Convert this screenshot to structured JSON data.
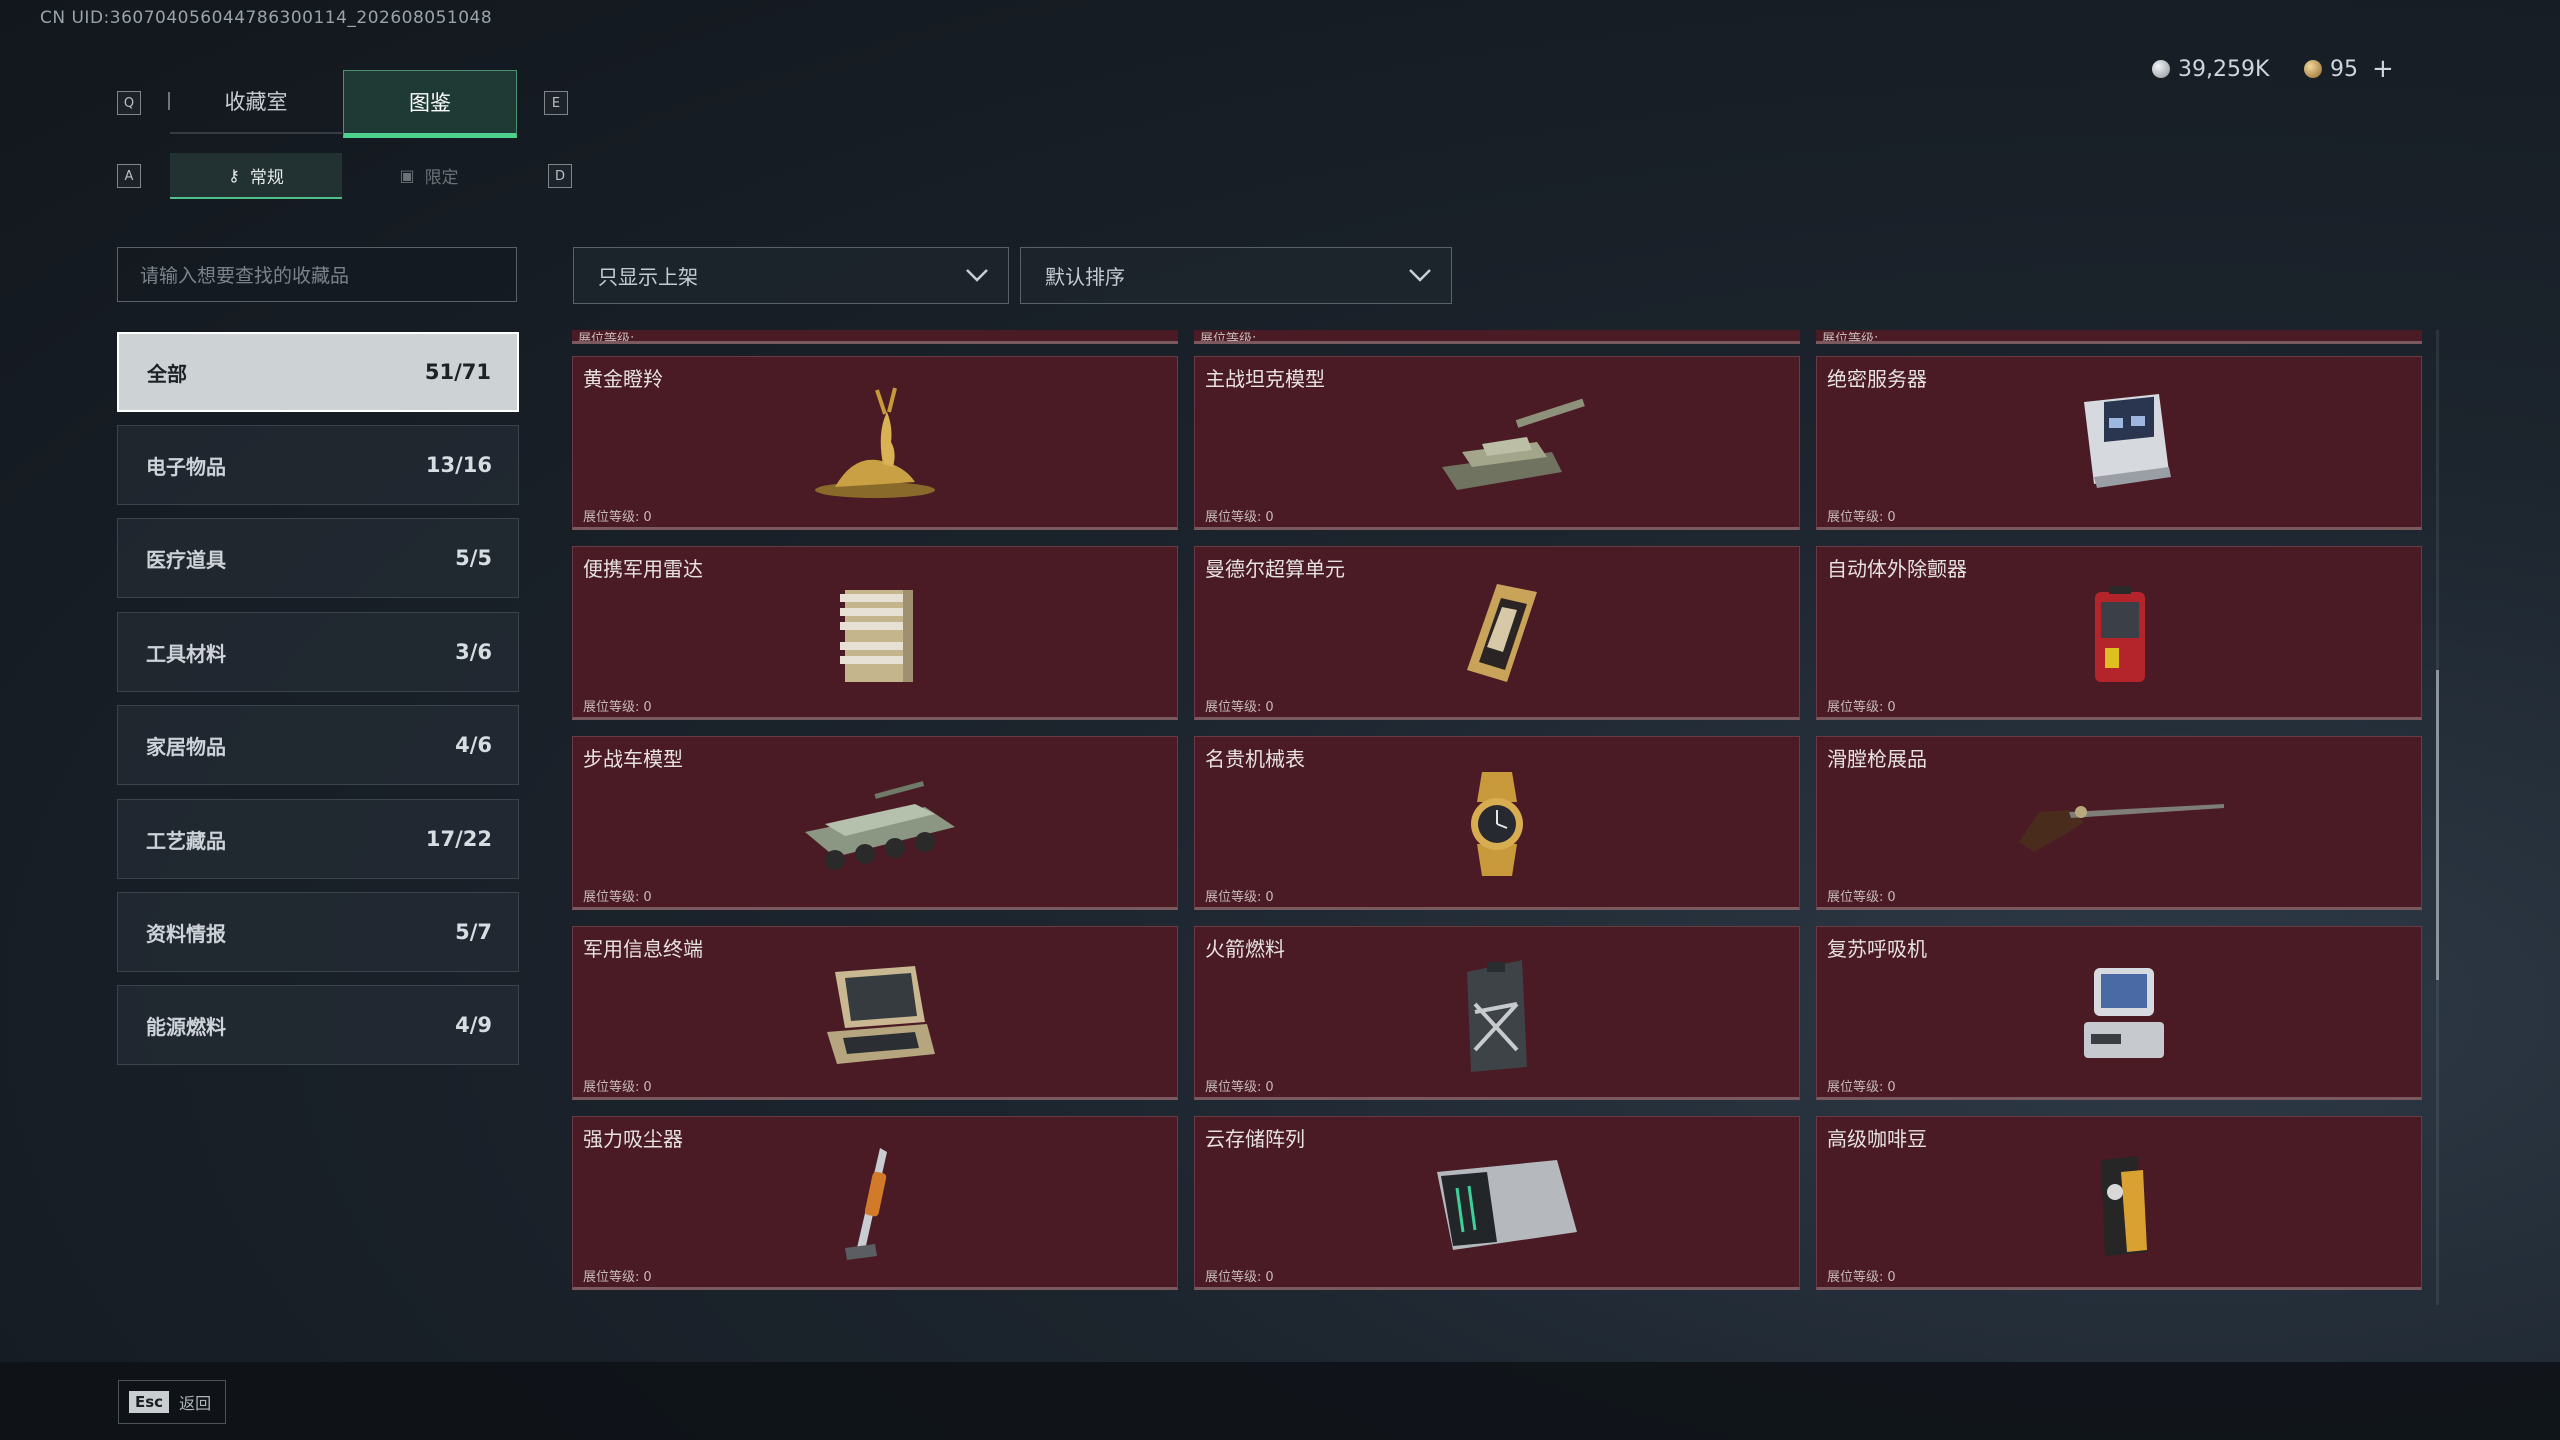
{
  "uid_text": "CN UID:360704056044786300114_202608051048",
  "keys": {
    "q": "Q",
    "e": "E",
    "a": "A",
    "d": "D",
    "esc": "Esc"
  },
  "main_tabs": [
    {
      "label": "收藏室",
      "active": false
    },
    {
      "label": "图鉴",
      "active": true
    }
  ],
  "sub_tabs": [
    {
      "label": "常规",
      "icon": "key-icon",
      "active": true
    },
    {
      "label": "限定",
      "icon": "lock-icon",
      "active": false
    }
  ],
  "currency": [
    {
      "icon": "silver-coin-icon",
      "value": "39,259K",
      "color": "#c9ccd0"
    },
    {
      "icon": "gold-coin-icon",
      "value": "95",
      "color": "#c9a15a",
      "add": "+"
    }
  ],
  "search": {
    "placeholder": "请输入想要查找的收藏品"
  },
  "filters": {
    "availability": "只显示上架",
    "sort": "默认排序"
  },
  "categories": [
    {
      "label": "全部",
      "count": "51/71",
      "active": true
    },
    {
      "label": "电子物品",
      "count": "13/16"
    },
    {
      "label": "医疗道具",
      "count": "5/5"
    },
    {
      "label": "工具材料",
      "count": "3/6"
    },
    {
      "label": "家居物品",
      "count": "4/6"
    },
    {
      "label": "工艺藏品",
      "count": "17/22"
    },
    {
      "label": "资料情报",
      "count": "5/7"
    },
    {
      "label": "能源燃料",
      "count": "4/9"
    }
  ],
  "level_label": "展位等级:",
  "items": [
    {
      "name": "黄金瞪羚",
      "level": "0",
      "icon": "gazelle-statue-icon"
    },
    {
      "name": "主战坦克模型",
      "level": "0",
      "icon": "tank-model-icon"
    },
    {
      "name": "绝密服务器",
      "level": "0",
      "icon": "server-icon"
    },
    {
      "name": "便携军用雷达",
      "level": "0",
      "icon": "radar-icon"
    },
    {
      "name": "曼德尔超算单元",
      "level": "0",
      "icon": "cpu-unit-icon"
    },
    {
      "name": "自动体外除颤器",
      "level": "0",
      "icon": "defibrillator-icon"
    },
    {
      "name": "步战车模型",
      "level": "0",
      "icon": "ifv-model-icon"
    },
    {
      "name": "名贵机械表",
      "level": "0",
      "icon": "watch-icon"
    },
    {
      "name": "滑膛枪展品",
      "level": "0",
      "icon": "musket-icon"
    },
    {
      "name": "军用信息终端",
      "level": "0",
      "icon": "terminal-icon"
    },
    {
      "name": "火箭燃料",
      "level": "0",
      "icon": "fuel-can-icon"
    },
    {
      "name": "复苏呼吸机",
      "level": "0",
      "icon": "ventilator-icon"
    },
    {
      "name": "强力吸尘器",
      "level": "0",
      "icon": "vacuum-icon"
    },
    {
      "name": "云存储阵列",
      "level": "0",
      "icon": "storage-array-icon"
    },
    {
      "name": "高级咖啡豆",
      "level": "0",
      "icon": "coffee-bag-icon"
    }
  ],
  "footer": {
    "back_label": "返回"
  }
}
